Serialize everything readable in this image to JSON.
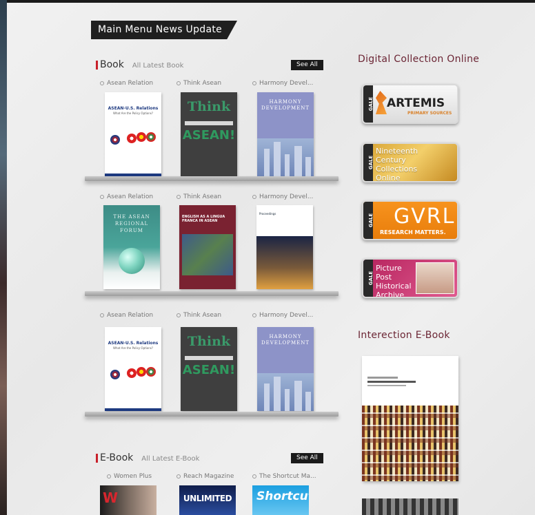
{
  "header": {
    "title": "Main Menu News Update"
  },
  "book_section": {
    "title": "Book",
    "subtitle": "All Latest Book",
    "see_all": "See All",
    "rows": [
      {
        "items": [
          {
            "label": "Asean Relation",
            "cover": "asean"
          },
          {
            "label": "Think Asean",
            "cover": "think"
          },
          {
            "label": "Harmony Devel...",
            "cover": "harmony"
          }
        ]
      },
      {
        "items": [
          {
            "label": "Asean Relation",
            "cover": "forum"
          },
          {
            "label": "Think Asean",
            "cover": "english"
          },
          {
            "label": "Harmony Devel...",
            "cover": "proc"
          }
        ]
      },
      {
        "items": [
          {
            "label": "Asean Relation",
            "cover": "asean"
          },
          {
            "label": "Think Asean",
            "cover": "think"
          },
          {
            "label": "Harmony Devel...",
            "cover": "harmony"
          }
        ]
      }
    ]
  },
  "covers": {
    "asean": {
      "title": "ASEAN-U.S. Relations",
      "subtitle": "What Are the Policy Options?"
    },
    "think": {
      "line1": "Think",
      "line2": "ASEAN!"
    },
    "harmony": {
      "title": "HARMONY DEVELOPMENT"
    },
    "forum": {
      "title": "THE ASEAN REGIONAL FORUM"
    },
    "english": {
      "title": "ENGLISH AS A LINGUA FRANCA IN ASEAN"
    },
    "proc": {
      "title": "Proceedings"
    }
  },
  "ebook_section": {
    "title": "E-Book",
    "subtitle": "All Latest E-Book",
    "see_all": "See All",
    "items": [
      {
        "label": "Women Plus"
      },
      {
        "label": "Reach Magazine"
      },
      {
        "label": "The Shortcut Ma..."
      }
    ],
    "cover_texts": {
      "women": "W",
      "reach": "UNLIMITED",
      "shortcut": "Shortcut"
    }
  },
  "digital_collection": {
    "title": "Digital Collection Online",
    "items": [
      {
        "tab": "GALE",
        "main": "ARTEMIS",
        "sub": "PRIMARY SOURCES"
      },
      {
        "tab": "GALE",
        "main": "Nineteenth Century Collections Online"
      },
      {
        "tab": "GALE",
        "main": "GVRL",
        "sub": "RESEARCH MATTERS."
      },
      {
        "tab": "GALE",
        "main": "Picture Post Historical Archive"
      }
    ]
  },
  "interaction_ebook": {
    "title": "Interection E-Book"
  },
  "colors": {
    "accent_red": "#c8202a",
    "title_maroon": "#6b2534",
    "banner": "#1f1f1f"
  }
}
